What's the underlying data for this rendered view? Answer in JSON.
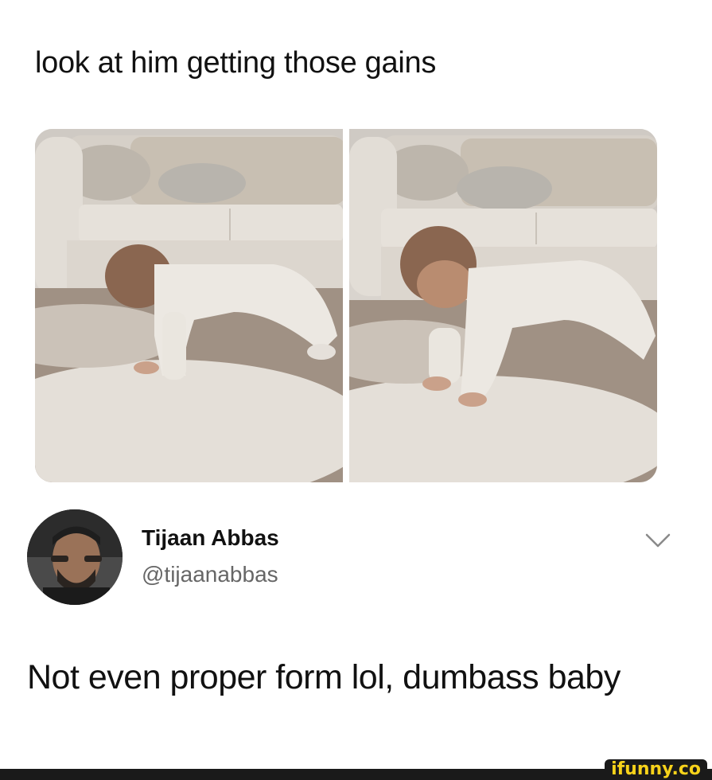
{
  "post": {
    "caption": "look at him getting those gains"
  },
  "tweet": {
    "display_name": "Tijaan Abbas",
    "handle": "@tijaanabbas",
    "text": "Not even proper form lol, dumbass baby",
    "more_icon": "chevron-down-icon"
  },
  "watermark": {
    "text": "ifunny.co",
    "color": "#f7d21a"
  },
  "colors": {
    "background": "#ffffff",
    "text": "#111111",
    "handle": "#666666"
  }
}
